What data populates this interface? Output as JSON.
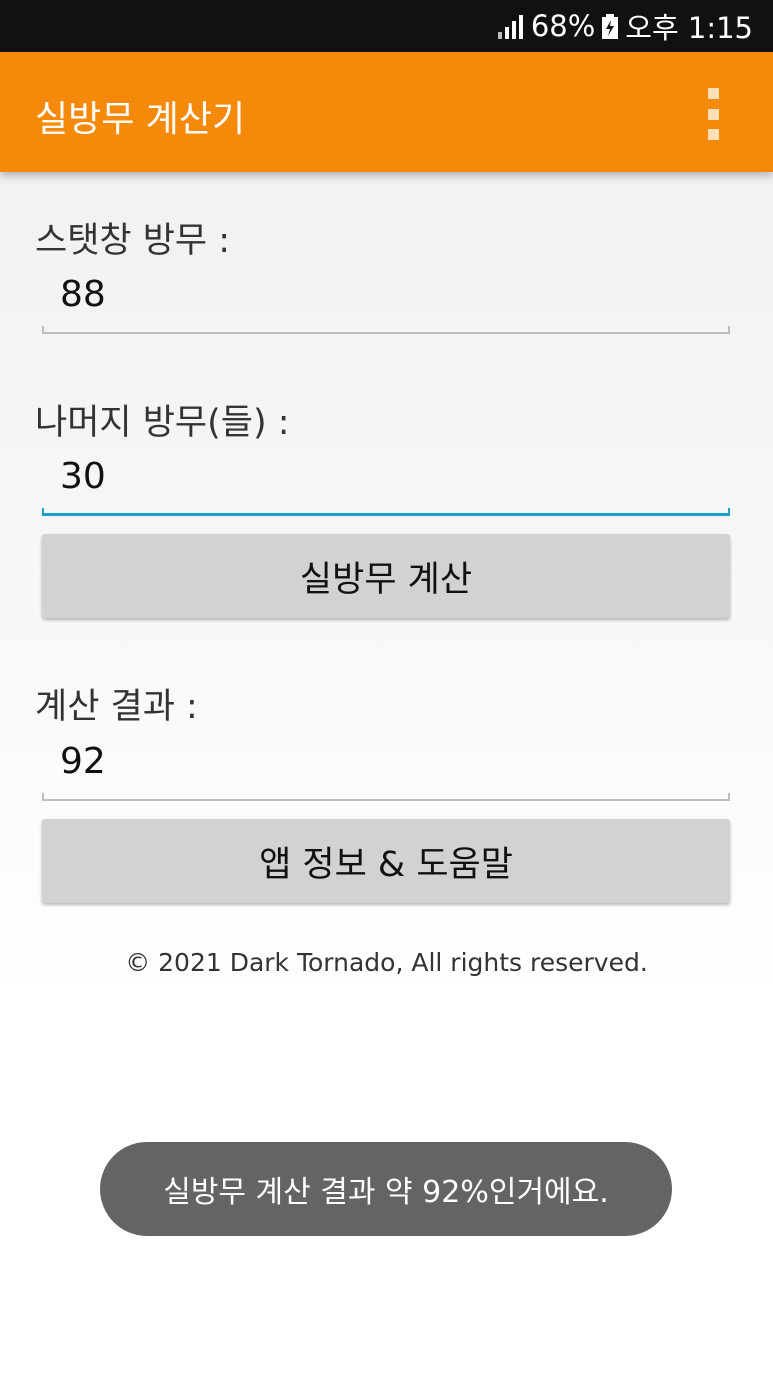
{
  "status_bar": {
    "battery": "68%",
    "time": "오후 1:15",
    "icons": [
      "signal-icon",
      "battery-charging-icon"
    ]
  },
  "app_bar": {
    "title": "실방무 계산기",
    "menu_icon": "overflow-menu-icon"
  },
  "form": {
    "stat_label": "스탯창 방무 :",
    "stat_value": "88",
    "rest_label": "나머지 방무(들) :",
    "rest_value": "30",
    "calc_button": "실방무 계산",
    "result_label": "계산 결과 :",
    "result_value": "92",
    "info_button": "앱 정보 & 도움말"
  },
  "footer": {
    "copyright": "© 2021 Dark Tornado, All rights reserved."
  },
  "toast": {
    "message": "실방무 계산 결과 약 92%인거에요."
  },
  "colors": {
    "accent": "#f4890a",
    "focus": "#1ba0c8",
    "toast_bg": "#646464"
  }
}
